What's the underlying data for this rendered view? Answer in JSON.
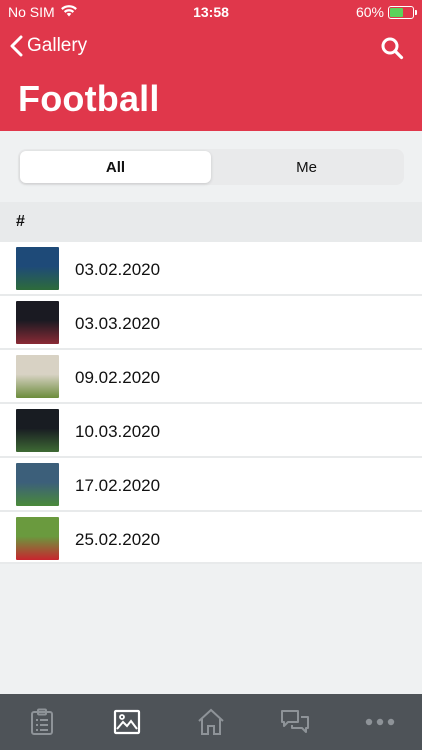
{
  "status_bar": {
    "carrier": "No SIM",
    "time": "13:58",
    "battery_percent": "60%",
    "battery_level": 0.6
  },
  "nav": {
    "back_label": "Gallery",
    "title": "Football"
  },
  "segments": [
    {
      "label": "All",
      "active": true
    },
    {
      "label": "Me",
      "active": false
    }
  ],
  "section": {
    "header": "#"
  },
  "items": [
    {
      "label": "03.02.2020",
      "thumb_colors": [
        "#1e4a78",
        "#2d6b3a"
      ]
    },
    {
      "label": "03.03.2020",
      "thumb_colors": [
        "#1a1a22",
        "#8a2a35"
      ]
    },
    {
      "label": "09.02.2020",
      "thumb_colors": [
        "#d8d2c4",
        "#6c8c3c"
      ]
    },
    {
      "label": "10.03.2020",
      "thumb_colors": [
        "#181c22",
        "#3e6a34"
      ]
    },
    {
      "label": "17.02.2020",
      "thumb_colors": [
        "#3c5f7a",
        "#4a8a3a"
      ]
    },
    {
      "label": "25.02.2020",
      "thumb_colors": [
        "#6a9a3e",
        "#c8252e"
      ]
    }
  ],
  "tabbar": {
    "tabs": [
      {
        "icon": "clipboard-icon",
        "active": false
      },
      {
        "icon": "gallery-icon",
        "active": true
      },
      {
        "icon": "home-icon",
        "active": false
      },
      {
        "icon": "chat-icon",
        "active": false
      },
      {
        "icon": "more-icon",
        "active": false
      }
    ]
  },
  "colors": {
    "brand": "#e0374b",
    "tabbar": "#4e5358",
    "tab_inactive": "#8e9398",
    "tab_active": "#ffffff"
  }
}
